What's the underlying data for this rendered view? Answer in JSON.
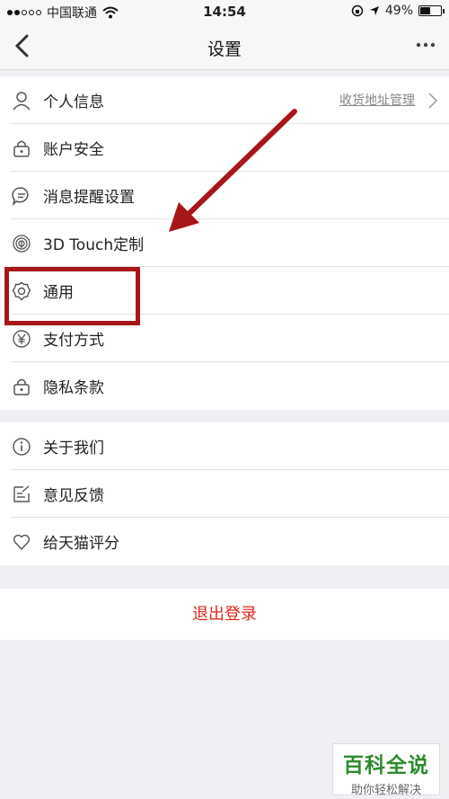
{
  "status_bar": {
    "carrier": "中国联通",
    "time": "14:54",
    "battery_text": "49%",
    "battery_level": 0.49
  },
  "nav": {
    "title": "设置"
  },
  "group1": {
    "items": [
      {
        "label": "个人信息",
        "icon": "person-icon",
        "extra": "收货地址管理"
      },
      {
        "label": "账户安全",
        "icon": "lock-icon"
      },
      {
        "label": "消息提醒设置",
        "icon": "message-icon"
      },
      {
        "label": "3D Touch定制",
        "icon": "fingerprint-icon"
      },
      {
        "label": "通用",
        "icon": "gear-icon"
      },
      {
        "label": "支付方式",
        "icon": "yen-icon"
      },
      {
        "label": "隐私条款",
        "icon": "lock-icon"
      }
    ]
  },
  "group2": {
    "items": [
      {
        "label": "关于我们",
        "icon": "info-icon"
      },
      {
        "label": "意见反馈",
        "icon": "feedback-icon"
      },
      {
        "label": "给天猫评分",
        "icon": "heart-icon"
      }
    ]
  },
  "logout_label": "退出登录",
  "watermark": {
    "name": "百科全说",
    "slogan": "助你轻松解决"
  },
  "colors": {
    "annotation": "#a8161a",
    "logout": "#e0261a",
    "watermark": "#2e8b2e"
  }
}
